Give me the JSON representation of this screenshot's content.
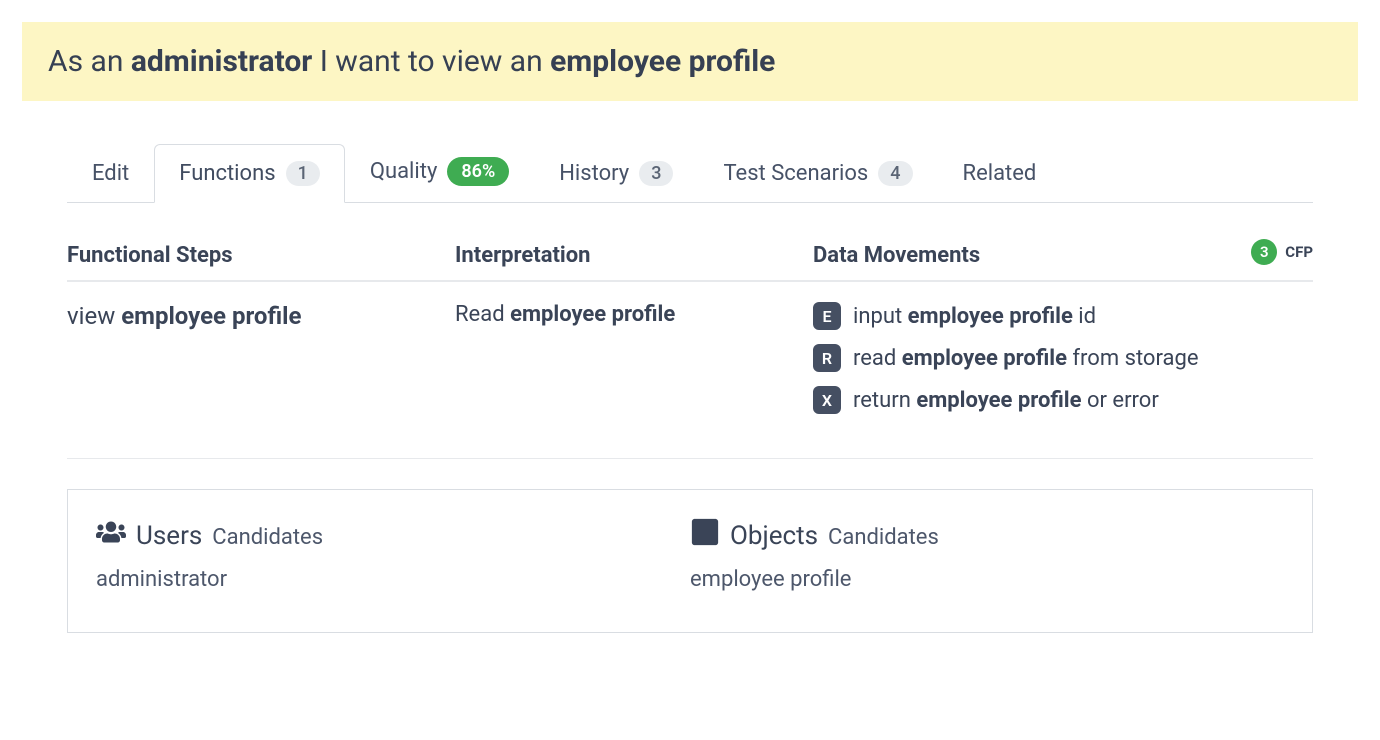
{
  "story": {
    "prefix": "As an ",
    "role": "administrator",
    "middle": " I want to view an ",
    "object": "employee profile"
  },
  "tabs": {
    "edit": "Edit",
    "functions": {
      "label": "Functions",
      "count": "1"
    },
    "quality": {
      "label": "Quality",
      "percent": "86%"
    },
    "history": {
      "label": "History",
      "count": "3"
    },
    "test_scenarios": {
      "label": "Test Scenarios",
      "count": "4"
    },
    "related": "Related"
  },
  "columns": {
    "steps": "Functional Steps",
    "interpretation": "Interpretation",
    "movements": "Data Movements",
    "cfp": {
      "count": "3",
      "label": "CFP"
    }
  },
  "row": {
    "step_prefix": "view ",
    "step_bold": "employee profile",
    "interp_prefix": "Read ",
    "interp_bold": "employee profile",
    "movements": [
      {
        "tag": "E",
        "pre": "input ",
        "bold": "employee profile",
        "post": " id"
      },
      {
        "tag": "R",
        "pre": "read ",
        "bold": "employee profile",
        "post": " from storage"
      },
      {
        "tag": "X",
        "pre": "return ",
        "bold": "employee profile",
        "post": " or error"
      }
    ]
  },
  "candidates": {
    "users": {
      "title": "Users",
      "sub": "Candidates",
      "value": "administrator"
    },
    "objects": {
      "title": "Objects",
      "sub": "Candidates",
      "value": "employee profile"
    }
  }
}
